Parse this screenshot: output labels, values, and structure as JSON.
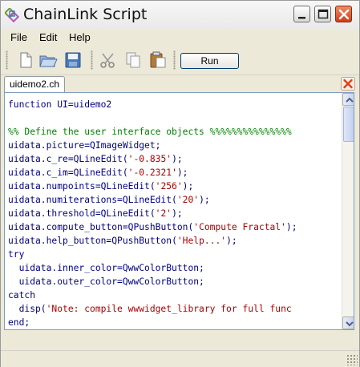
{
  "window": {
    "title": "ChainLink Script"
  },
  "menu": {
    "file": "File",
    "edit": "Edit",
    "help": "Help"
  },
  "toolbar": {
    "run_label": "Run"
  },
  "tab": {
    "label": "uidemo2.ch"
  },
  "icons": {
    "app": "chain-link-icon",
    "new": "new-file-icon",
    "open": "open-folder-icon",
    "save": "save-floppy-icon",
    "cut": "scissors-icon",
    "copy": "copy-icon",
    "paste": "paste-clipboard-icon",
    "tab_close": "close-tab-icon"
  },
  "colors": {
    "keyword": "#000080",
    "comment": "#008000",
    "string": "#aa0000",
    "close_button": "#d23c14"
  },
  "code": {
    "lines": [
      [
        {
          "t": "function UI=uidemo2",
          "c": "kw"
        }
      ],
      [
        {
          "t": "",
          "c": "pl"
        }
      ],
      [
        {
          "t": "%% Define the user interface objects %%%%%%%%%%%%%%%",
          "c": "cm"
        }
      ],
      [
        {
          "t": "uidata.picture=",
          "c": "kw"
        },
        {
          "t": "QImageWidget",
          "c": "fn"
        },
        {
          "t": ";",
          "c": "kw"
        }
      ],
      [
        {
          "t": "uidata.c_re=",
          "c": "kw"
        },
        {
          "t": "QLineEdit",
          "c": "fn"
        },
        {
          "t": "(",
          "c": "kw"
        },
        {
          "t": "'-0.835'",
          "c": "st"
        },
        {
          "t": ");",
          "c": "kw"
        }
      ],
      [
        {
          "t": "uidata.c_im=",
          "c": "kw"
        },
        {
          "t": "QLineEdit",
          "c": "fn"
        },
        {
          "t": "(",
          "c": "kw"
        },
        {
          "t": "'-0.2321'",
          "c": "st"
        },
        {
          "t": ");",
          "c": "kw"
        }
      ],
      [
        {
          "t": "uidata.numpoints=",
          "c": "kw"
        },
        {
          "t": "QLineEdit",
          "c": "fn"
        },
        {
          "t": "(",
          "c": "kw"
        },
        {
          "t": "'256'",
          "c": "st"
        },
        {
          "t": ");",
          "c": "kw"
        }
      ],
      [
        {
          "t": "uidata.numiterations=",
          "c": "kw"
        },
        {
          "t": "QLineEdit",
          "c": "fn"
        },
        {
          "t": "(",
          "c": "kw"
        },
        {
          "t": "'20'",
          "c": "st"
        },
        {
          "t": ");",
          "c": "kw"
        }
      ],
      [
        {
          "t": "uidata.threshold=",
          "c": "kw"
        },
        {
          "t": "QLineEdit",
          "c": "fn"
        },
        {
          "t": "(",
          "c": "kw"
        },
        {
          "t": "'2'",
          "c": "st"
        },
        {
          "t": ");",
          "c": "kw"
        }
      ],
      [
        {
          "t": "uidata.compute_button=",
          "c": "kw"
        },
        {
          "t": "QPushButton",
          "c": "fn"
        },
        {
          "t": "(",
          "c": "kw"
        },
        {
          "t": "'Compute Fractal'",
          "c": "st"
        },
        {
          "t": ");",
          "c": "kw"
        }
      ],
      [
        {
          "t": "uidata.help_button=",
          "c": "kw"
        },
        {
          "t": "QPushButton",
          "c": "fn"
        },
        {
          "t": "(",
          "c": "kw"
        },
        {
          "t": "'Help...'",
          "c": "st"
        },
        {
          "t": ");",
          "c": "kw"
        }
      ],
      [
        {
          "t": "try",
          "c": "kw"
        }
      ],
      [
        {
          "t": "  uidata.inner_color=",
          "c": "kw"
        },
        {
          "t": "QwwColorButton",
          "c": "fn"
        },
        {
          "t": ";",
          "c": "kw"
        }
      ],
      [
        {
          "t": "  uidata.outer_color=",
          "c": "kw"
        },
        {
          "t": "QwwColorButton",
          "c": "fn"
        },
        {
          "t": ";",
          "c": "kw"
        }
      ],
      [
        {
          "t": "catch",
          "c": "kw"
        }
      ],
      [
        {
          "t": "  disp(",
          "c": "kw"
        },
        {
          "t": "'Note: compile wwwidget_library for full func",
          "c": "st"
        }
      ],
      [
        {
          "t": "end;",
          "c": "kw"
        }
      ]
    ]
  }
}
